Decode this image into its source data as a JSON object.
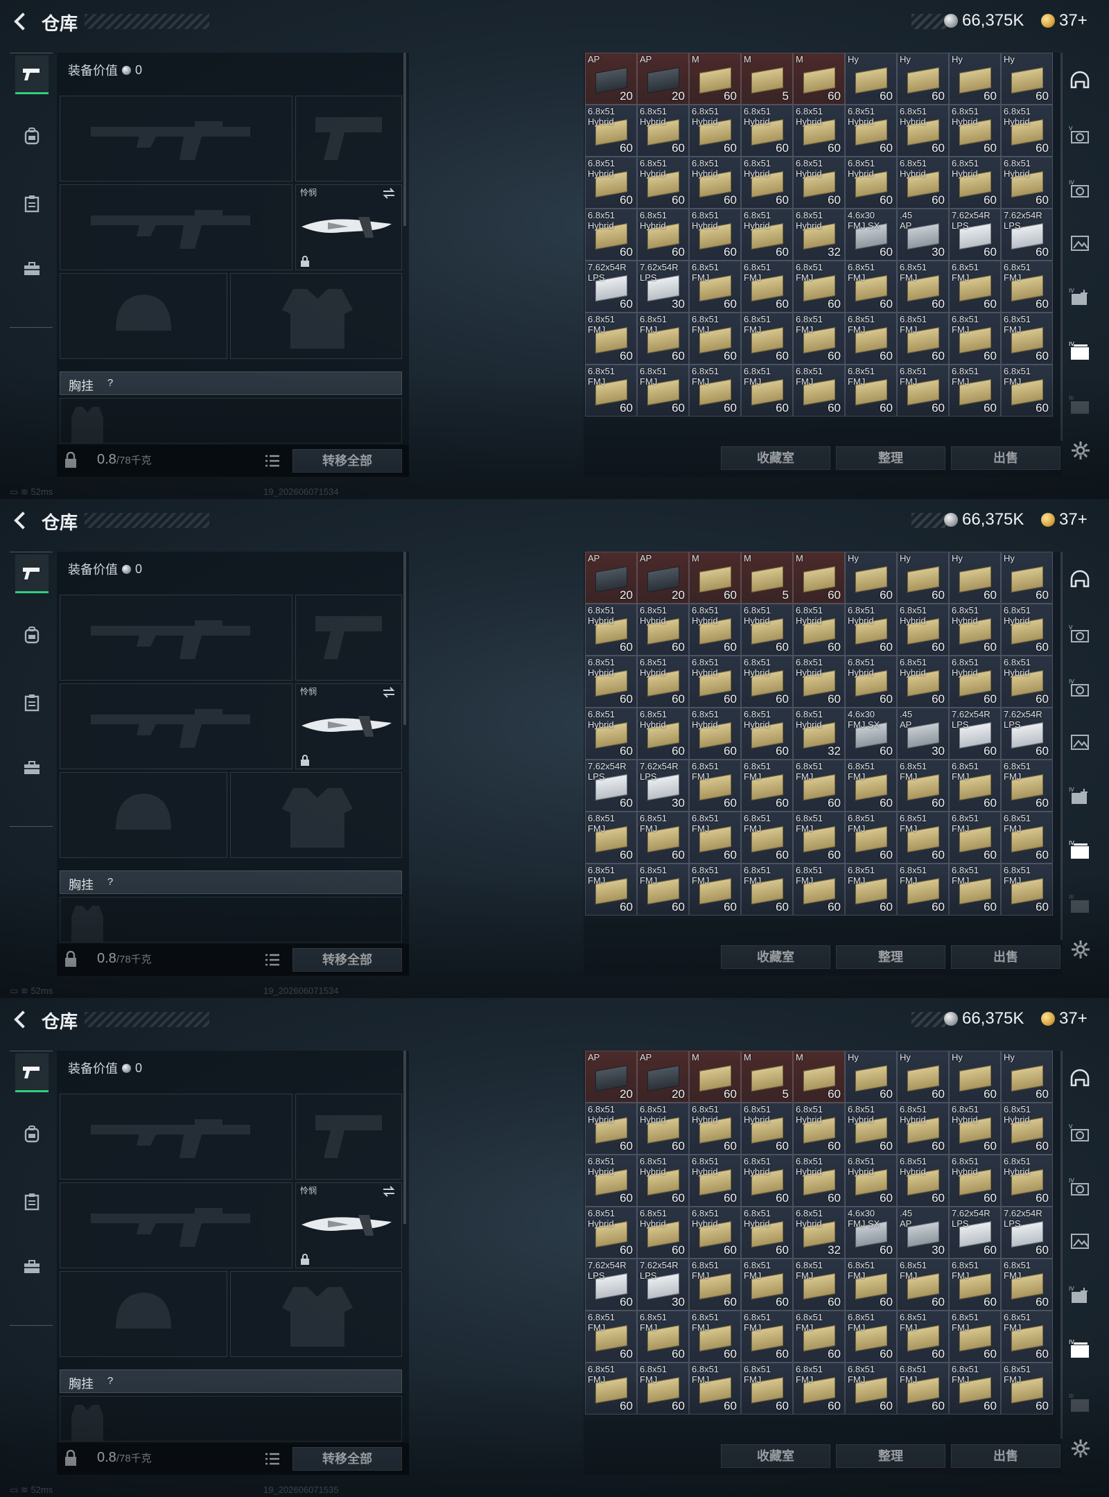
{
  "panels": [
    {
      "title": "仓库",
      "currency": {
        "silver": "66,375K",
        "gold": "37+"
      },
      "equipment": {
        "value_label": "装备价值",
        "value": "0",
        "knife_label": "怜悯",
        "vest_label": "胸挂",
        "help": "?",
        "weight": "0.8",
        "weight_max": "/78千克",
        "transfer_all": "转移全部"
      },
      "status": {
        "ping": "52ms",
        "build": "19_202606071534"
      },
      "buttons": {
        "collection": "收藏室",
        "organize": "整理",
        "sell": "出售"
      }
    },
    {
      "title": "仓库",
      "currency": {
        "silver": "66,375K",
        "gold": "37+"
      },
      "equipment": {
        "value_label": "装备价值",
        "value": "0",
        "knife_label": "怜悯",
        "vest_label": "胸挂",
        "help": "?",
        "weight": "0.8",
        "weight_max": "/78千克",
        "transfer_all": "转移全部"
      },
      "status": {
        "ping": "52ms",
        "build": "19_202606071534"
      },
      "buttons": {
        "collection": "收藏室",
        "organize": "整理",
        "sell": "出售"
      }
    },
    {
      "title": "仓库",
      "currency": {
        "silver": "66,375K",
        "gold": "37+"
      },
      "equipment": {
        "value_label": "装备价值",
        "value": "0",
        "knife_label": "怜悯",
        "vest_label": "胸挂",
        "help": "?",
        "weight": "0.8",
        "weight_max": "/78千克",
        "transfer_all": "转移全部"
      },
      "status": {
        "ping": "52ms",
        "build": "19_202606071535"
      },
      "buttons": {
        "collection": "收藏室",
        "organize": "整理",
        "sell": "出售"
      }
    }
  ],
  "inventory": {
    "top_row": [
      {
        "n1": "AP",
        "n2": "",
        "q": "20",
        "box": "dark",
        "bg": "red"
      },
      {
        "n1": "AP",
        "n2": "",
        "q": "20",
        "box": "dark",
        "bg": "red"
      },
      {
        "n1": "M",
        "n2": "",
        "q": "60",
        "box": "tan",
        "bg": "red"
      },
      {
        "n1": "M",
        "n2": "",
        "q": "5",
        "box": "tan",
        "bg": "red"
      },
      {
        "n1": "M",
        "n2": "",
        "q": "60",
        "box": "tan",
        "bg": "red"
      },
      {
        "n1": "Hy",
        "n2": "",
        "q": "60",
        "box": "tan",
        "bg": ""
      },
      {
        "n1": "Hy",
        "n2": "",
        "q": "60",
        "box": "tan",
        "bg": ""
      },
      {
        "n1": "Hy",
        "n2": "",
        "q": "60",
        "box": "tan",
        "bg": ""
      },
      {
        "n1": "Hy",
        "n2": "",
        "q": "60",
        "box": "tan",
        "bg": ""
      }
    ],
    "rows": [
      [
        {
          "n1": "6.8x51",
          "n2": "Hybrid",
          "q": "60",
          "box": "tan"
        },
        {
          "n1": "6.8x51",
          "n2": "Hybrid",
          "q": "60",
          "box": "tan"
        },
        {
          "n1": "6.8x51",
          "n2": "Hybrid",
          "q": "60",
          "box": "tan"
        },
        {
          "n1": "6.8x51",
          "n2": "Hybrid",
          "q": "60",
          "box": "tan"
        },
        {
          "n1": "6.8x51",
          "n2": "Hybrid",
          "q": "60",
          "box": "tan"
        },
        {
          "n1": "6.8x51",
          "n2": "Hybrid",
          "q": "60",
          "box": "tan"
        },
        {
          "n1": "6.8x51",
          "n2": "Hybrid",
          "q": "60",
          "box": "tan"
        },
        {
          "n1": "6.8x51",
          "n2": "Hybrid",
          "q": "60",
          "box": "tan"
        },
        {
          "n1": "6.8x51",
          "n2": "Hybrid",
          "q": "60",
          "box": "tan"
        }
      ],
      [
        {
          "n1": "6.8x51",
          "n2": "Hybrid",
          "q": "60",
          "box": "tan"
        },
        {
          "n1": "6.8x51",
          "n2": "Hybrid",
          "q": "60",
          "box": "tan"
        },
        {
          "n1": "6.8x51",
          "n2": "Hybrid",
          "q": "60",
          "box": "tan"
        },
        {
          "n1": "6.8x51",
          "n2": "Hybrid",
          "q": "60",
          "box": "tan"
        },
        {
          "n1": "6.8x51",
          "n2": "Hybrid",
          "q": "60",
          "box": "tan"
        },
        {
          "n1": "6.8x51",
          "n2": "Hybrid",
          "q": "60",
          "box": "tan"
        },
        {
          "n1": "6.8x51",
          "n2": "Hybrid",
          "q": "60",
          "box": "tan"
        },
        {
          "n1": "6.8x51",
          "n2": "Hybrid",
          "q": "60",
          "box": "tan"
        },
        {
          "n1": "6.8x51",
          "n2": "Hybrid",
          "q": "60",
          "box": "tan"
        }
      ],
      [
        {
          "n1": "6.8x51",
          "n2": "Hybrid",
          "q": "60",
          "box": "tan"
        },
        {
          "n1": "6.8x51",
          "n2": "Hybrid",
          "q": "60",
          "box": "tan"
        },
        {
          "n1": "6.8x51",
          "n2": "Hybrid",
          "q": "60",
          "box": "tan"
        },
        {
          "n1": "6.8x51",
          "n2": "Hybrid",
          "q": "60",
          "box": "tan"
        },
        {
          "n1": "6.8x51",
          "n2": "Hybrid",
          "q": "32",
          "box": "tan"
        },
        {
          "n1": "4.6x30",
          "n2": "FMJ SX",
          "q": "60",
          "box": "silver"
        },
        {
          "n1": ".45",
          "n2": "AP",
          "q": "30",
          "box": "silver"
        },
        {
          "n1": "7.62x54R",
          "n2": "LPS",
          "q": "60",
          "box": "white"
        },
        {
          "n1": "7.62x54R",
          "n2": "LPS",
          "q": "60",
          "box": "white"
        }
      ],
      [
        {
          "n1": "7.62x54R",
          "n2": "LPS",
          "q": "60",
          "box": "white"
        },
        {
          "n1": "7.62x54R",
          "n2": "LPS",
          "q": "30",
          "box": "white"
        },
        {
          "n1": "6.8x51",
          "n2": "FMJ",
          "q": "60",
          "box": "tan"
        },
        {
          "n1": "6.8x51",
          "n2": "FMJ",
          "q": "60",
          "box": "tan"
        },
        {
          "n1": "6.8x51",
          "n2": "FMJ",
          "q": "60",
          "box": "tan"
        },
        {
          "n1": "6.8x51",
          "n2": "FMJ",
          "q": "60",
          "box": "tan"
        },
        {
          "n1": "6.8x51",
          "n2": "FMJ",
          "q": "60",
          "box": "tan"
        },
        {
          "n1": "6.8x51",
          "n2": "FMJ",
          "q": "60",
          "box": "tan"
        },
        {
          "n1": "6.8x51",
          "n2": "FMJ",
          "q": "60",
          "box": "tan"
        }
      ],
      [
        {
          "n1": "6.8x51",
          "n2": "FMJ",
          "q": "60",
          "box": "tan"
        },
        {
          "n1": "6.8x51",
          "n2": "FMJ",
          "q": "60",
          "box": "tan"
        },
        {
          "n1": "6.8x51",
          "n2": "FMJ",
          "q": "60",
          "box": "tan"
        },
        {
          "n1": "6.8x51",
          "n2": "FMJ",
          "q": "60",
          "box": "tan"
        },
        {
          "n1": "6.8x51",
          "n2": "FMJ",
          "q": "60",
          "box": "tan"
        },
        {
          "n1": "6.8x51",
          "n2": "FMJ",
          "q": "60",
          "box": "tan"
        },
        {
          "n1": "6.8x51",
          "n2": "FMJ",
          "q": "60",
          "box": "tan"
        },
        {
          "n1": "6.8x51",
          "n2": "FMJ",
          "q": "60",
          "box": "tan"
        },
        {
          "n1": "6.8x51",
          "n2": "FMJ",
          "q": "60",
          "box": "tan"
        }
      ],
      [
        {
          "n1": "6.8x51",
          "n2": "FMJ",
          "q": "60",
          "box": "tan"
        },
        {
          "n1": "6.8x51",
          "n2": "FMJ",
          "q": "60",
          "box": "tan"
        },
        {
          "n1": "6.8x51",
          "n2": "FMJ",
          "q": "60",
          "box": "tan"
        },
        {
          "n1": "6.8x51",
          "n2": "FMJ",
          "q": "60",
          "box": "tan"
        },
        {
          "n1": "6.8x51",
          "n2": "FMJ",
          "q": "60",
          "box": "tan"
        },
        {
          "n1": "6.8x51",
          "n2": "FMJ",
          "q": "60",
          "box": "tan"
        },
        {
          "n1": "6.8x51",
          "n2": "FMJ",
          "q": "60",
          "box": "tan"
        },
        {
          "n1": "6.8x51",
          "n2": "FMJ",
          "q": "60",
          "box": "tan"
        },
        {
          "n1": "6.8x51",
          "n2": "FMJ",
          "q": "60",
          "box": "tan"
        }
      ]
    ]
  },
  "icons": {
    "nav": [
      "pistol-icon",
      "backpack-icon",
      "clipboard-icon",
      "briefcase-icon"
    ],
    "right_sidebar": [
      "helmet-icon",
      "camera-v-icon",
      "camera-iv-icon",
      "photo-icon",
      "camera-add-iv-icon",
      "gallery-iv-icon",
      "gallery-iii-icon"
    ],
    "accent": "#2fd07d"
  }
}
